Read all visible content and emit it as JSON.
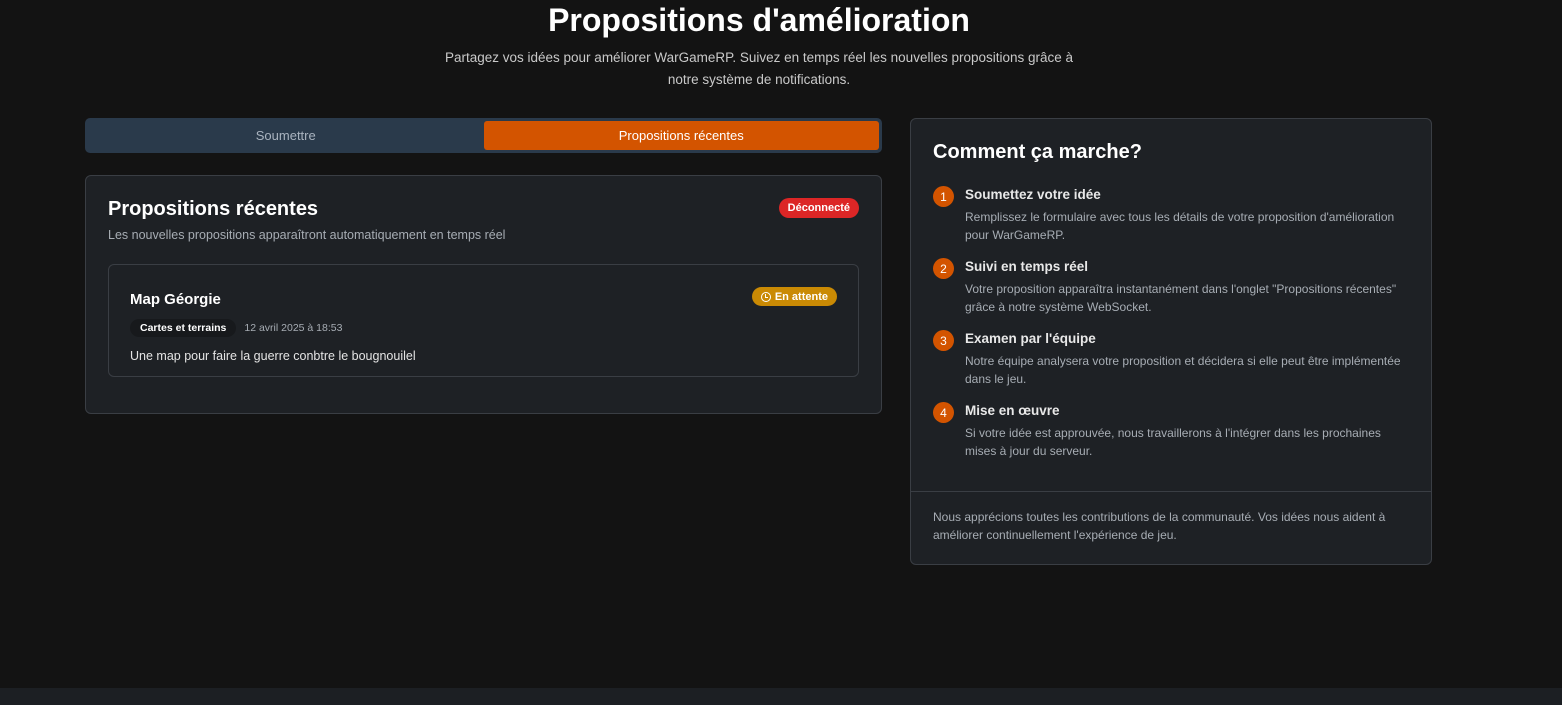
{
  "header": {
    "title": "Propositions d'amélioration",
    "subtitle": "Partagez vos idées pour améliorer WarGameRP. Suivez en temps réel les nouvelles propositions grâce à notre système de notifications."
  },
  "tabs": [
    {
      "label": "Soumettre",
      "active": false
    },
    {
      "label": "Propositions récentes",
      "active": true
    }
  ],
  "recent": {
    "title": "Propositions récentes",
    "description": "Les nouvelles propositions apparaîtront automatiquement en temps réel",
    "connection_status": "Déconnecté",
    "items": [
      {
        "title": "Map Géorgie",
        "status": "En attente",
        "category": "Cartes et terrains",
        "date": "12 avril 2025 à 18:53",
        "description": "Une map pour faire la guerre conbtre le bougnouilel"
      }
    ]
  },
  "how_it_works": {
    "title": "Comment ça marche?",
    "steps": [
      {
        "number": "1",
        "title": "Soumettez votre idée",
        "description": "Remplissez le formulaire avec tous les détails de votre proposition d'amélioration pour WarGameRP."
      },
      {
        "number": "2",
        "title": "Suivi en temps réel",
        "description": "Votre proposition apparaîtra instantanément dans l'onglet \"Propositions récentes\" grâce à notre système WebSocket."
      },
      {
        "number": "3",
        "title": "Examen par l'équipe",
        "description": "Notre équipe analysera votre proposition et décidera si elle peut être implémentée dans le jeu."
      },
      {
        "number": "4",
        "title": "Mise en œuvre",
        "description": "Si votre idée est approuvée, nous travaillerons à l'intégrer dans les prochaines mises à jour du serveur."
      }
    ],
    "footer": "Nous apprécions toutes les contributions de la communauté. Vos idées nous aident à améliorer continuellement l'expérience de jeu."
  },
  "colors": {
    "accent": "#d35400",
    "disconnected": "#dc2626",
    "pending": "#ca8a04",
    "background": "#131313"
  }
}
